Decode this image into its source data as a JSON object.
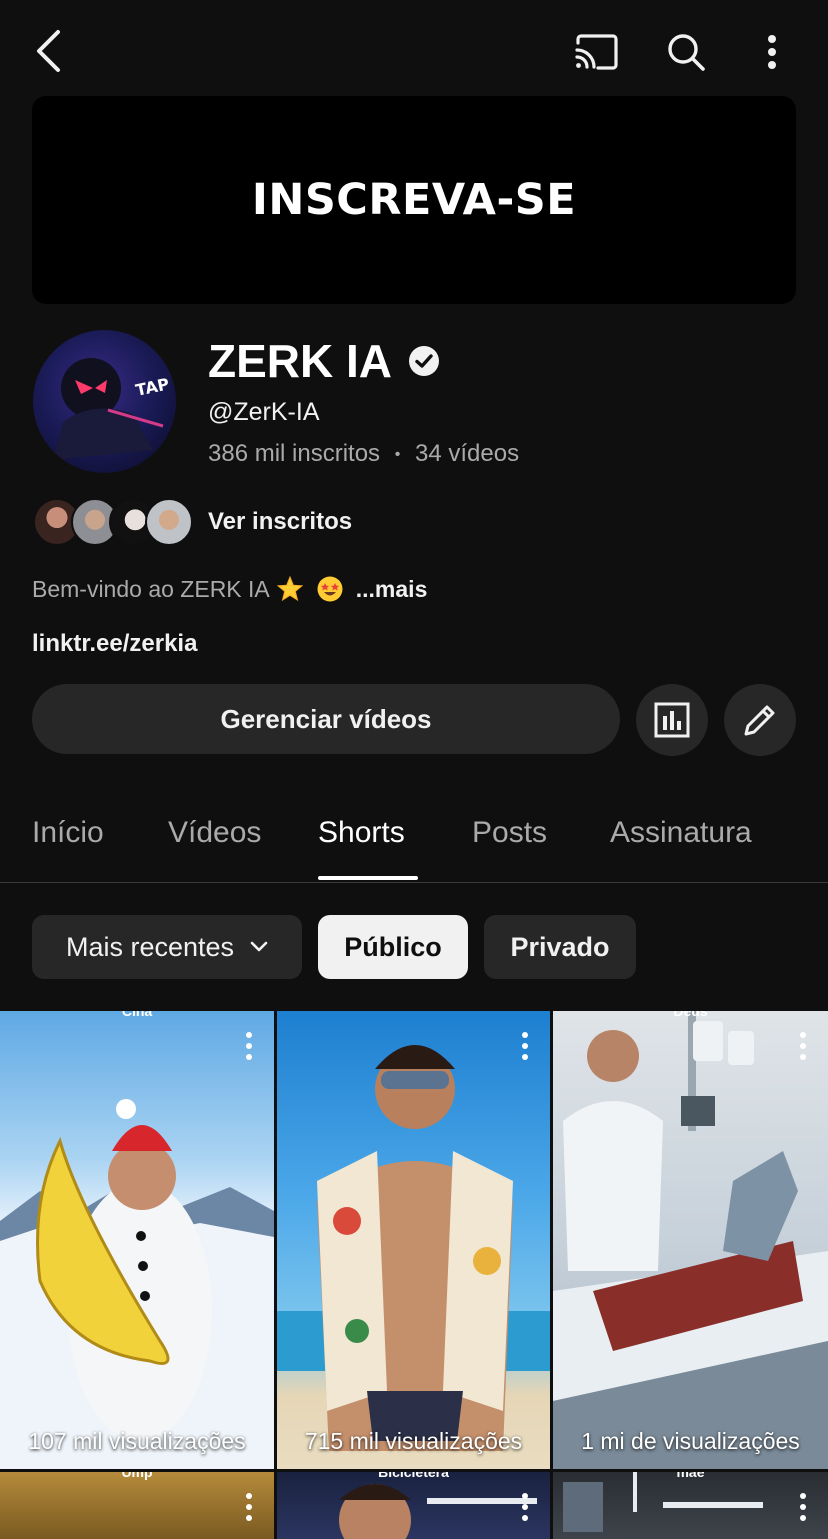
{
  "banner": {
    "text": "INSCREVA-SE"
  },
  "channel": {
    "name": "ZERK IA",
    "handle": "@ZerK-IA",
    "subscribers": "386 mil inscritos",
    "separator": "•",
    "videos": "34 vídeos",
    "avatar_text": "TAP"
  },
  "subscribers_link": "Ver inscritos",
  "description": {
    "text": "Bem-vindo ao ZERK IA",
    "more": "...mais"
  },
  "link": "linktr.ee/zerkia",
  "actions": {
    "manage_label": "Gerenciar vídeos"
  },
  "tabs": [
    {
      "label": "Início",
      "active": false
    },
    {
      "label": "Vídeos",
      "active": false
    },
    {
      "label": "Shorts",
      "active": true
    },
    {
      "label": "Posts",
      "active": false
    },
    {
      "label": "Assinatura",
      "active": false
    }
  ],
  "filters": {
    "sort_label": "Mais recentes",
    "chips": [
      {
        "label": "Público",
        "selected": true
      },
      {
        "label": "Privado",
        "selected": false
      }
    ]
  },
  "shorts": [
    {
      "views": "107 mil visualizações",
      "top_caption": "Cina"
    },
    {
      "views": "715 mil visualizações",
      "top_caption": ""
    },
    {
      "views": "1 mi de visualizações",
      "top_caption": "Deus"
    },
    {
      "views": "",
      "top_caption": "Ump"
    },
    {
      "views": "",
      "top_caption": "Bicicletera"
    },
    {
      "views": "",
      "top_caption": "mãe"
    }
  ],
  "icons": {
    "back": "back-arrow-icon",
    "cast": "cast-icon",
    "search": "search-icon",
    "more": "more-vertical-icon",
    "verified": "verified-check-icon",
    "stats": "analytics-icon",
    "edit": "pencil-icon",
    "dropdown": "chevron-down-icon"
  },
  "colors": {
    "background": "#0f0f0f",
    "surface": "#272727",
    "muted_text": "#aaaaaa",
    "text": "#f1f1f1"
  }
}
